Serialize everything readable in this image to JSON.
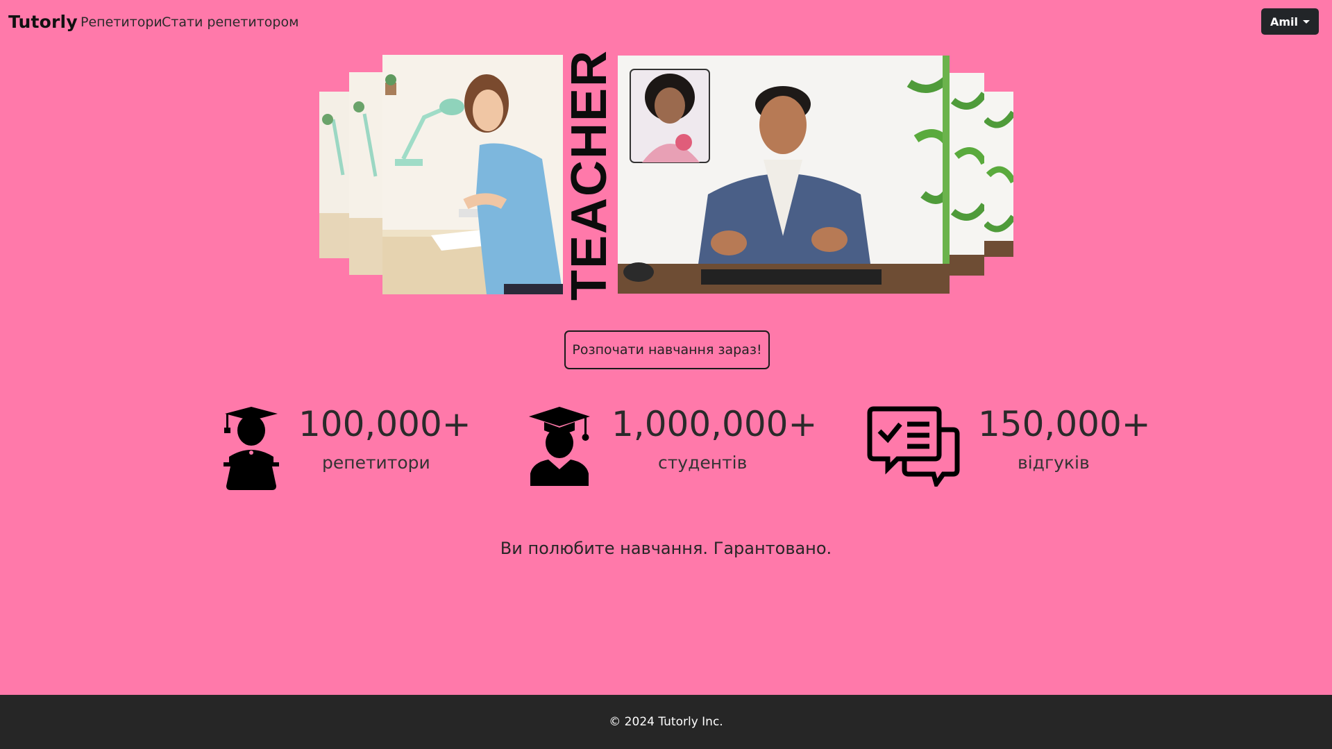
{
  "nav": {
    "brand": "Tutorly",
    "links": [
      {
        "label": "Репетитори"
      },
      {
        "label": "Стати репетитором"
      }
    ],
    "user": {
      "name": "Amil"
    }
  },
  "hero": {
    "word": "TEACHER"
  },
  "cta": {
    "label": "Розпочати навчання зараз!"
  },
  "stats": [
    {
      "number": "100,000+",
      "label": "репетитори",
      "icon": "tutor-laptop-icon"
    },
    {
      "number": "1,000,000+",
      "label": "студентів",
      "icon": "student-graduate-icon"
    },
    {
      "number": "150,000+",
      "label": "відгуків",
      "icon": "review-chat-icon"
    }
  ],
  "tagline": "Ви полюбите навчання. Гарантовано.",
  "footer": {
    "copyright": "© 2024 Tutorly Inc."
  },
  "colors": {
    "background": "#ff79aa",
    "footer": "#262626",
    "user_button": "#222528"
  }
}
